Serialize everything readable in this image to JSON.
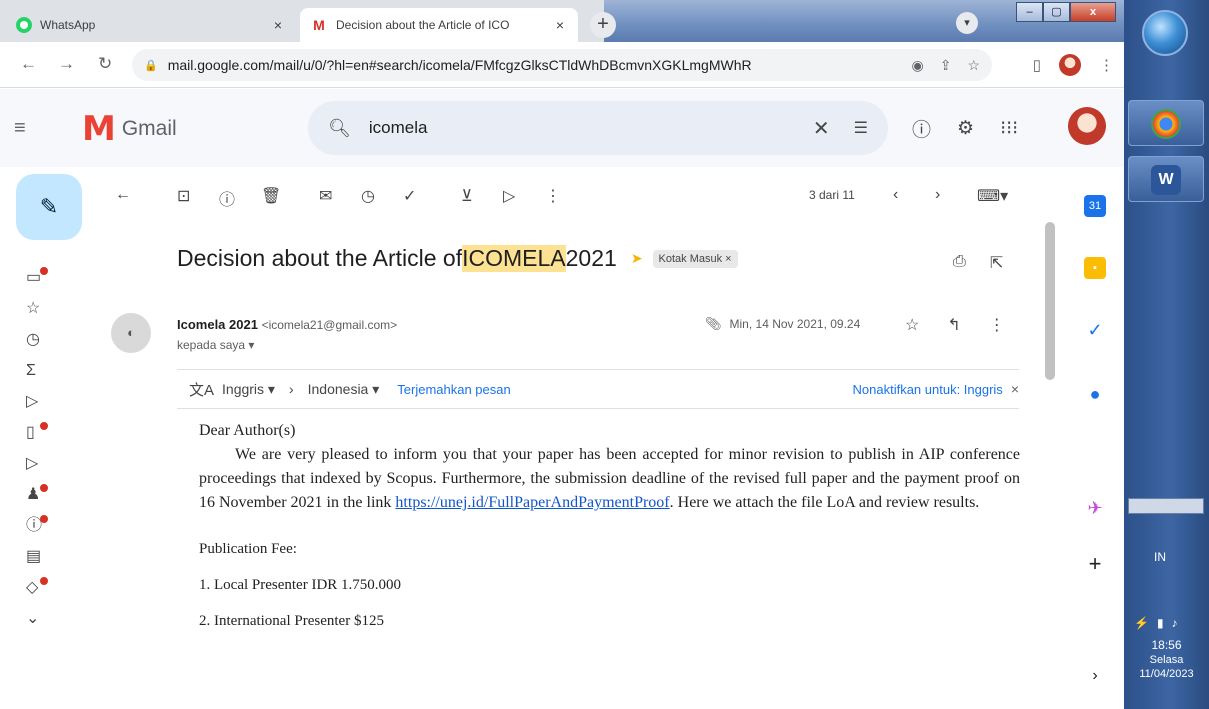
{
  "browser": {
    "tabs": [
      {
        "title": "WhatsApp",
        "close": "×"
      },
      {
        "title": "Decision about the Article of ICO",
        "close": "×"
      }
    ],
    "new_tab": "+",
    "url": "mail.google.com/mail/u/0/?hl=en#search/icomela/FMfcgzGlksCTldWhDBcmvnXGKLmgMWhR",
    "window_buttons": {
      "min": "–",
      "max": "▢",
      "close": "x"
    }
  },
  "gmail": {
    "logo_text": "Gmail",
    "search_value": "icomela",
    "pager": "3 dari 11",
    "subject_pre": "Decision about the Article of ",
    "subject_highlight": "ICOMELA",
    "subject_post": " 2021",
    "label_chip": "Kotak Masuk ×",
    "sender_name": "Icomela 2021",
    "sender_email": "<icomela21@gmail.com>",
    "to_line": "kepada saya ▾",
    "date": "Min, 14 Nov 2021, 09.24",
    "translate": {
      "from": "Inggris ▾",
      "to": "Indonesia ▾",
      "action": "Terjemahkan pesan",
      "disable": "Nonaktifkan untuk: Inggris",
      "disable_x": "×"
    },
    "body": {
      "greeting": "Dear Author(s)",
      "para_text": "We are very pleased to inform you that your paper has been accepted for minor revision to publish in AIP conference proceedings that indexed by Scopus. Furthermore, the submission deadline of the revised full paper and the payment proof on 16 November 2021 in the link ",
      "link_text": "https://unej.id/FullPaperAndPaymentProof",
      "para_end": ". Here we attach the file LoA and review results.",
      "fee_title": "Publication Fee:",
      "fee_1": "1. Local Presenter IDR 1.750.000",
      "fee_2": "2. International Presenter $125"
    }
  },
  "taskbar": {
    "lang": "IN",
    "time": "18:56",
    "day": "Selasa",
    "date": "11/04/2023"
  }
}
